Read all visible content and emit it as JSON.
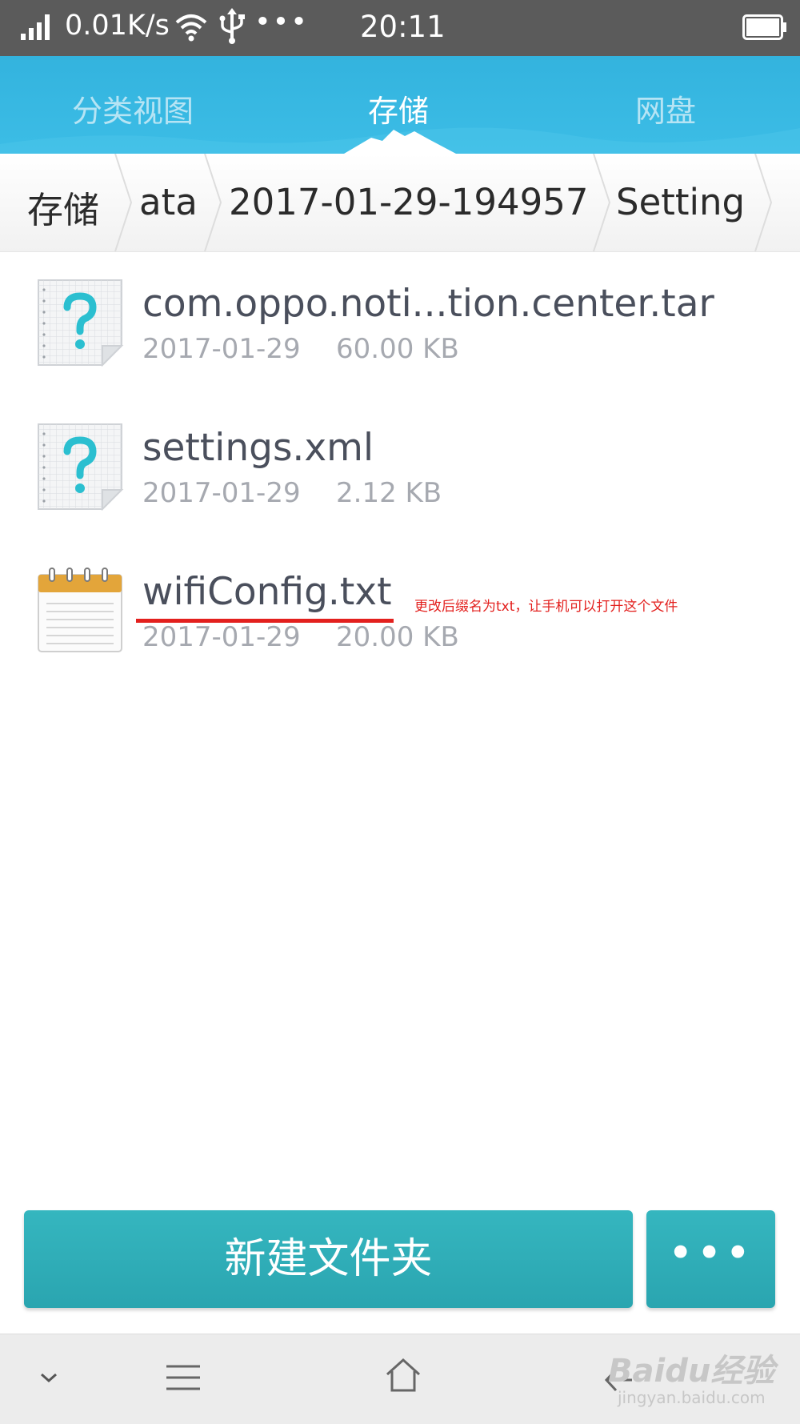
{
  "status_bar": {
    "speed": "0.01K/s",
    "dots": "•••",
    "time": "20:11",
    "icons": [
      "signal-icon",
      "wifi-icon",
      "usb-icon",
      "battery-icon"
    ]
  },
  "tabs": [
    {
      "label": "分类视图",
      "active": false
    },
    {
      "label": "存储",
      "active": true
    },
    {
      "label": "网盘",
      "active": false
    }
  ],
  "breadcrumb": [
    "存储",
    "ata",
    "2017-01-29-194957",
    "Setting"
  ],
  "files": [
    {
      "name": "com.oppo.noti...tion.center.tar",
      "date": "2017-01-29",
      "size": "60.00 KB",
      "icon": "unknown-file-icon"
    },
    {
      "name": "settings.xml",
      "date": "2017-01-29",
      "size": "2.12 KB",
      "icon": "unknown-file-icon"
    },
    {
      "name": "wifiConfig.txt",
      "date": "2017-01-29",
      "size": "20.00 KB",
      "icon": "notepad-icon"
    }
  ],
  "annotation": "更改后缀名为txt，让手机可以打开这个文件",
  "actions": {
    "new_folder": "新建文件夹",
    "more": "•••"
  },
  "nav": [
    "chevron-down-icon",
    "menu-icon",
    "home-icon",
    "back-icon"
  ],
  "watermark": {
    "main": "Baidu经验",
    "sub": "jingyan.baidu.com"
  },
  "colors": {
    "tab_bar": "#3cbde6",
    "button": "#2eaab4",
    "annotation": "#e3201e",
    "status_bar": "#5b5b5b"
  }
}
